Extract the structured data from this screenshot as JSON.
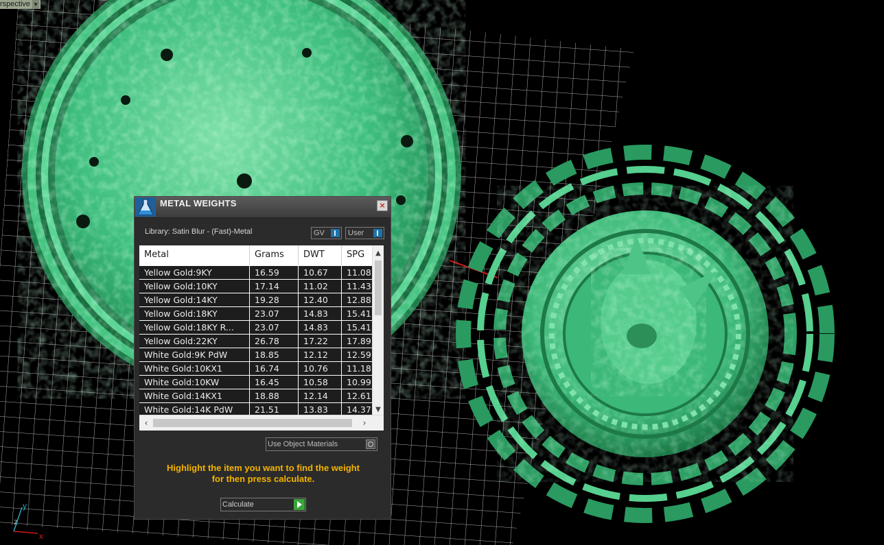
{
  "viewport": {
    "label": "rspective"
  },
  "axis": {
    "x": "x",
    "y": "y",
    "z": "z"
  },
  "dialog": {
    "title": "METAL WEIGHTS",
    "close_icon": "close-icon",
    "library": "Library: Satin Blur - (Fast)-Metal",
    "gv_label": "GV",
    "user_label": "User",
    "columns": [
      "Metal",
      "Grams",
      "DWT",
      "SPG"
    ],
    "rows": [
      [
        "Yellow Gold:9KY",
        "16.59",
        "10.67",
        "11.08"
      ],
      [
        "Yellow Gold:10KY",
        "17.14",
        "11.02",
        "11.43"
      ],
      [
        "Yellow Gold:14KY",
        "19.28",
        "12.40",
        "12.88"
      ],
      [
        "Yellow Gold:18KY",
        "23.07",
        "14.83",
        "15.41"
      ],
      [
        "Yellow Gold:18KY R...",
        "23.07",
        "14.83",
        "15.41"
      ],
      [
        "Yellow Gold:22KY",
        "26.78",
        "17.22",
        "17.89"
      ],
      [
        "White Gold:9K PdW",
        "18.85",
        "12.12",
        "12.59"
      ],
      [
        "White Gold:10KX1",
        "16.74",
        "10.76",
        "11.18"
      ],
      [
        "White Gold:10KW",
        "16.45",
        "10.58",
        "10.99"
      ],
      [
        "White Gold:14KX1",
        "18.88",
        "12.14",
        "12.61"
      ],
      [
        "White Gold:14K PdW",
        "21.51",
        "13.83",
        "14.37"
      ]
    ],
    "use_object_materials": "Use Object Materials",
    "hint_line1": "Highlight the item you want to find the weight",
    "hint_line2": "for then press calculate.",
    "calculate_label": "Calculate"
  },
  "colors": {
    "model_green": "#3fbf7f",
    "hint": "#f4b400",
    "grid": "#d9d9d9"
  }
}
